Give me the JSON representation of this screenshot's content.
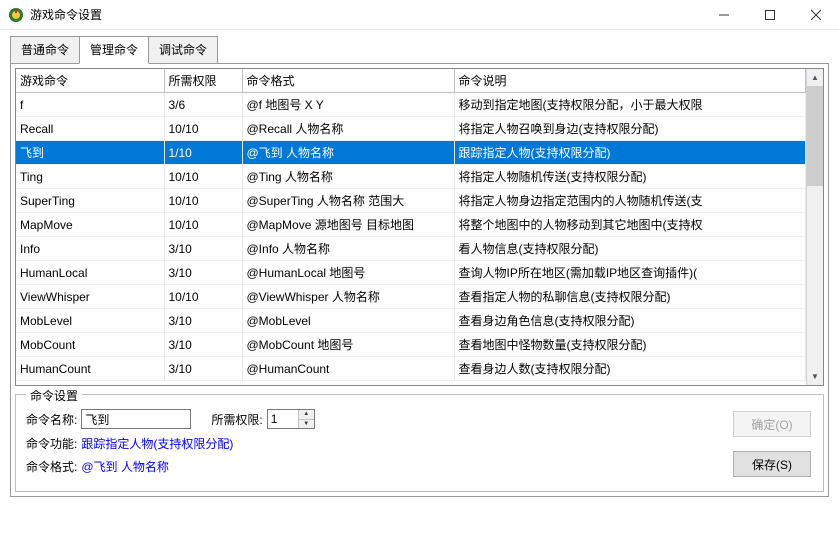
{
  "window": {
    "title": "游戏命令设置"
  },
  "tabs": {
    "normal": "普通命令",
    "admin": "管理命令",
    "debug": "调试命令"
  },
  "table": {
    "headers": {
      "cmd": "游戏命令",
      "perm": "所需权限",
      "fmt": "命令格式",
      "desc": "命令说明"
    },
    "rows": [
      {
        "cmd": "f",
        "perm": "3/6",
        "fmt": "@f 地图号 X Y",
        "desc": "移动到指定地图(支持权限分配，小于最大权限"
      },
      {
        "cmd": "Recall",
        "perm": "10/10",
        "fmt": "@Recall 人物名称",
        "desc": "将指定人物召唤到身边(支持权限分配)"
      },
      {
        "cmd": "飞到",
        "perm": "1/10",
        "fmt": "@飞到 人物名称",
        "desc": "跟踪指定人物(支持权限分配)"
      },
      {
        "cmd": "Ting",
        "perm": "10/10",
        "fmt": "@Ting 人物名称",
        "desc": "将指定人物随机传送(支持权限分配)"
      },
      {
        "cmd": "SuperTing",
        "perm": "10/10",
        "fmt": "@SuperTing 人物名称 范围大",
        "desc": "将指定人物身边指定范围内的人物随机传送(支"
      },
      {
        "cmd": "MapMove",
        "perm": "10/10",
        "fmt": "@MapMove 源地图号 目标地图",
        "desc": "将整个地图中的人物移动到其它地图中(支持权"
      },
      {
        "cmd": "Info",
        "perm": "3/10",
        "fmt": "@Info 人物名称",
        "desc": "看人物信息(支持权限分配)"
      },
      {
        "cmd": "HumanLocal",
        "perm": "3/10",
        "fmt": "@HumanLocal 地图号",
        "desc": "查询人物IP所在地区(需加载IP地区查询插件)("
      },
      {
        "cmd": "ViewWhisper",
        "perm": "10/10",
        "fmt": "@ViewWhisper 人物名称",
        "desc": "查看指定人物的私聊信息(支持权限分配)"
      },
      {
        "cmd": "MobLevel",
        "perm": "3/10",
        "fmt": "@MobLevel",
        "desc": "查看身边角色信息(支持权限分配)"
      },
      {
        "cmd": "MobCount",
        "perm": "3/10",
        "fmt": "@MobCount 地图号",
        "desc": "查看地图中怪物数量(支持权限分配)"
      },
      {
        "cmd": "HumanCount",
        "perm": "3/10",
        "fmt": "@HumanCount",
        "desc": "查看身边人数(支持权限分配)"
      }
    ],
    "selected_index": 2
  },
  "settings": {
    "group_title": "命令设置",
    "name_label": "命令名称:",
    "name_value": "飞到",
    "perm_label": "所需权限:",
    "perm_value": "1",
    "func_label": "命令功能:",
    "func_value": "跟踪指定人物(支持权限分配)",
    "fmt_label": "命令格式:",
    "fmt_value": "@飞到 人物名称"
  },
  "buttons": {
    "confirm": "确定(O)",
    "save": "保存(S)"
  }
}
